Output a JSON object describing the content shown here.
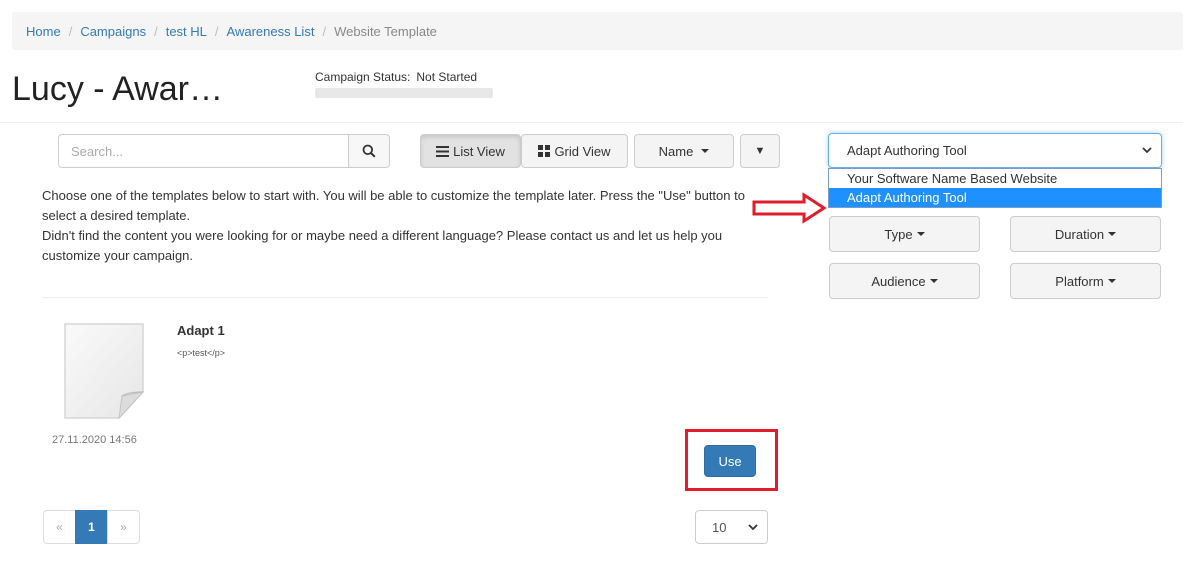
{
  "breadcrumb": {
    "items": [
      "Home",
      "Campaigns",
      "test HL",
      "Awareness List"
    ],
    "current": "Website Template",
    "separator": "/"
  },
  "page": {
    "title": "Lucy - Awar…"
  },
  "campaign_status": {
    "label": "Campaign Status:",
    "value": "Not Started"
  },
  "search": {
    "placeholder": "Search..."
  },
  "toolbar": {
    "list_view_label": "List View",
    "grid_view_label": "Grid View",
    "sort_label": "Name",
    "sort_dir_symbol": "▼"
  },
  "template_select": {
    "selected": "Adapt Authoring Tool",
    "options": [
      "Your Software Name Based Website",
      "Adapt Authoring Tool"
    ],
    "highlighted_index": 1
  },
  "intro": {
    "line1": "Choose one of the templates below to start with. You will be able to customize the template later. Press the \"Use\" button to select a desired template.",
    "line2": "Didn't find the content you were looking for or maybe need a different language? Please contact us and let us help you customize your campaign."
  },
  "filters": {
    "type_label": "Type",
    "duration_label": "Duration",
    "audience_label": "Audience",
    "platform_label": "Platform"
  },
  "items": [
    {
      "title": "Adapt 1",
      "description": "<p>test</p>",
      "date": "27.11.2020 14:56",
      "use_label": "Use"
    }
  ],
  "pagination": {
    "prev": "«",
    "current": "1",
    "next": "»"
  },
  "per_page": {
    "value": "10"
  },
  "colors": {
    "accent": "#337ab7",
    "annotation_red": "#e11d2b",
    "dropdown_highlight": "#1e90ff"
  },
  "icons": {
    "search": "search-icon",
    "list_view": "list-icon",
    "grid_view": "grid-icon",
    "chevron": "chevron-down-icon",
    "arrow": "right-arrow-icon",
    "thumbnail": "document-icon"
  }
}
